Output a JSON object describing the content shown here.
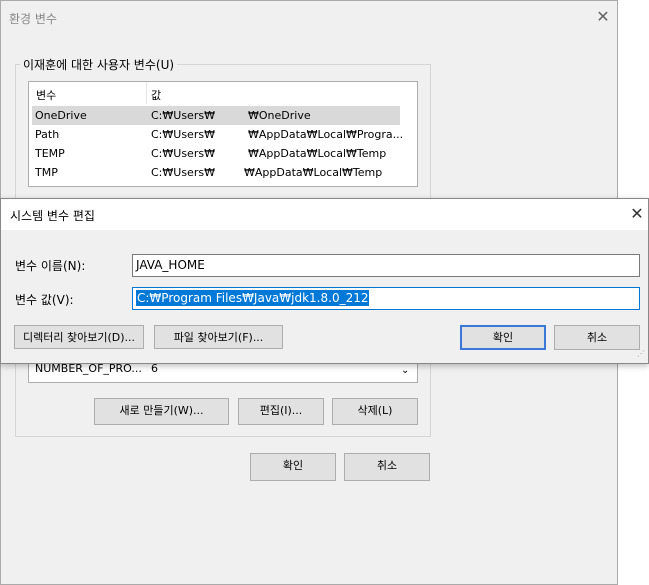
{
  "env_window": {
    "title": "환경 변수",
    "user_group_label": "이재훈에 대한 사용자 변수(U)",
    "columns": [
      "변수",
      "값"
    ],
    "user_vars": [
      {
        "name": "OneDrive",
        "value_prefix": "C:₩Users₩",
        "value_suffix": "₩OneDrive"
      },
      {
        "name": "Path",
        "value_prefix": "C:₩Users₩",
        "value_suffix": "₩AppData₩Local₩Progra..."
      },
      {
        "name": "TEMP",
        "value_prefix": "C:₩Users₩",
        "value_suffix": "₩AppData₩Local₩Temp"
      },
      {
        "name": "TMP",
        "value_prefix": "C:₩Users₩",
        "value_suffix": "₩AppData₩Local₩Temp"
      }
    ],
    "system_combo": {
      "name": "NUMBER_OF_PRO...",
      "value": "6"
    },
    "new_button": "새로 만들기(W)...",
    "edit_button": "편집(I)...",
    "delete_button": "삭제(L)",
    "ok_button": "확인",
    "cancel_button": "취소"
  },
  "edit_dialog": {
    "title": "시스템 변수 편집",
    "name_label": "변수 이름(N):",
    "name_value": "JAVA_HOME",
    "value_label": "변수 값(V):",
    "value_value": "C:₩Program Files₩Java₩jdk1.8.0_212",
    "browse_dir_button": "디렉터리 찾아보기(D)...",
    "browse_file_button": "파일 찾아보기(F)...",
    "ok_button": "확인",
    "cancel_button": "취소"
  },
  "icons": {
    "close": "close-icon",
    "dropdown": "chevron-down-icon"
  }
}
